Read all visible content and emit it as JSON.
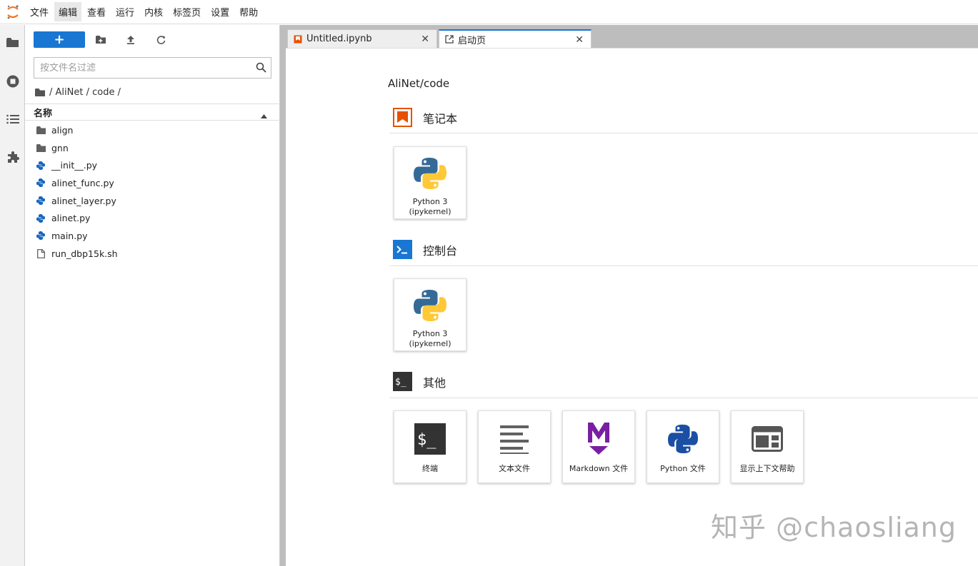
{
  "menubar": {
    "items": [
      "文件",
      "编辑",
      "查看",
      "运行",
      "内核",
      "标签页",
      "设置",
      "帮助"
    ],
    "active_index": 1
  },
  "filebrowser": {
    "new_button_label": "+",
    "filter_placeholder": "按文件名过滤",
    "breadcrumb": "/ AliNet / code /",
    "column_name": "名称",
    "files": [
      {
        "name": "align",
        "type": "folder-icon"
      },
      {
        "name": "gnn",
        "type": "folder-icon"
      },
      {
        "name": "__init__.py",
        "type": "python-icon"
      },
      {
        "name": "alinet_func.py",
        "type": "python-icon"
      },
      {
        "name": "alinet_layer.py",
        "type": "python-icon"
      },
      {
        "name": "alinet.py",
        "type": "python-icon"
      },
      {
        "name": "main.py",
        "type": "python-icon"
      },
      {
        "name": "run_dbp15k.sh",
        "type": "file-icon"
      }
    ]
  },
  "tabs": [
    {
      "label": "Untitled.ipynb",
      "close": "✕",
      "active": false
    },
    {
      "label": "启动页",
      "close": "✕",
      "active": true
    }
  ],
  "launcher": {
    "cwd": "AliNet/code",
    "sections": {
      "notebook": {
        "title": "笔记本",
        "cards": [
          {
            "line1": "Python 3",
            "line2": "(ipykernel)"
          }
        ]
      },
      "console": {
        "title": "控制台",
        "cards": [
          {
            "line1": "Python 3",
            "line2": "(ipykernel)"
          }
        ]
      },
      "other": {
        "title": "其他",
        "cards": [
          {
            "label": "终端",
            "icon": "terminal-icon"
          },
          {
            "label": "文本文件",
            "icon": "text-file-icon"
          },
          {
            "label": "Markdown 文件",
            "icon": "markdown-icon"
          },
          {
            "label": "Python 文件",
            "icon": "python-file-icon"
          },
          {
            "label": "显示上下文帮助",
            "icon": "context-help-icon"
          }
        ]
      }
    }
  },
  "watermark": "知乎 @chaosliang",
  "colors": {
    "accent": "#1976d2",
    "notebook_orange": "#e65100",
    "markdown_purple": "#7b1fa2"
  }
}
